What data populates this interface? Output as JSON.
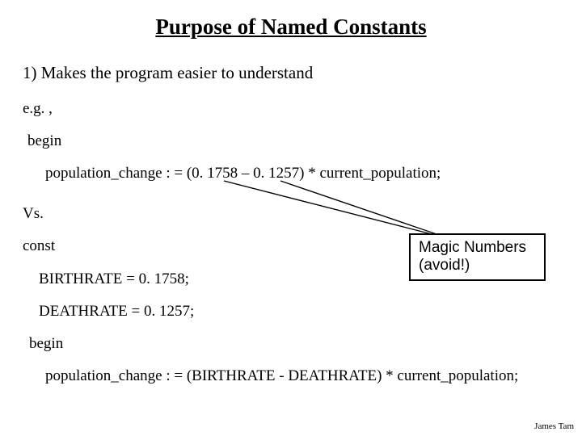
{
  "title": "Purpose of Named Constants",
  "bullet1": "1) Makes the program easier to understand",
  "eg": "e.g. ,",
  "begin1": "begin",
  "code1": "population_change : = (0. 1758 – 0. 1257) * current_population;",
  "vs": "Vs.",
  "const": "const",
  "birth": "BIRTHRATE = 0. 1758;",
  "death": "DEATHRATE = 0. 1257;",
  "begin2": "begin",
  "code2": "population_change : = (BIRTHRATE - DEATHRATE) * current_population;",
  "callout_l1": "Magic Numbers",
  "callout_l2": "(avoid!)",
  "footer": "James Tam"
}
